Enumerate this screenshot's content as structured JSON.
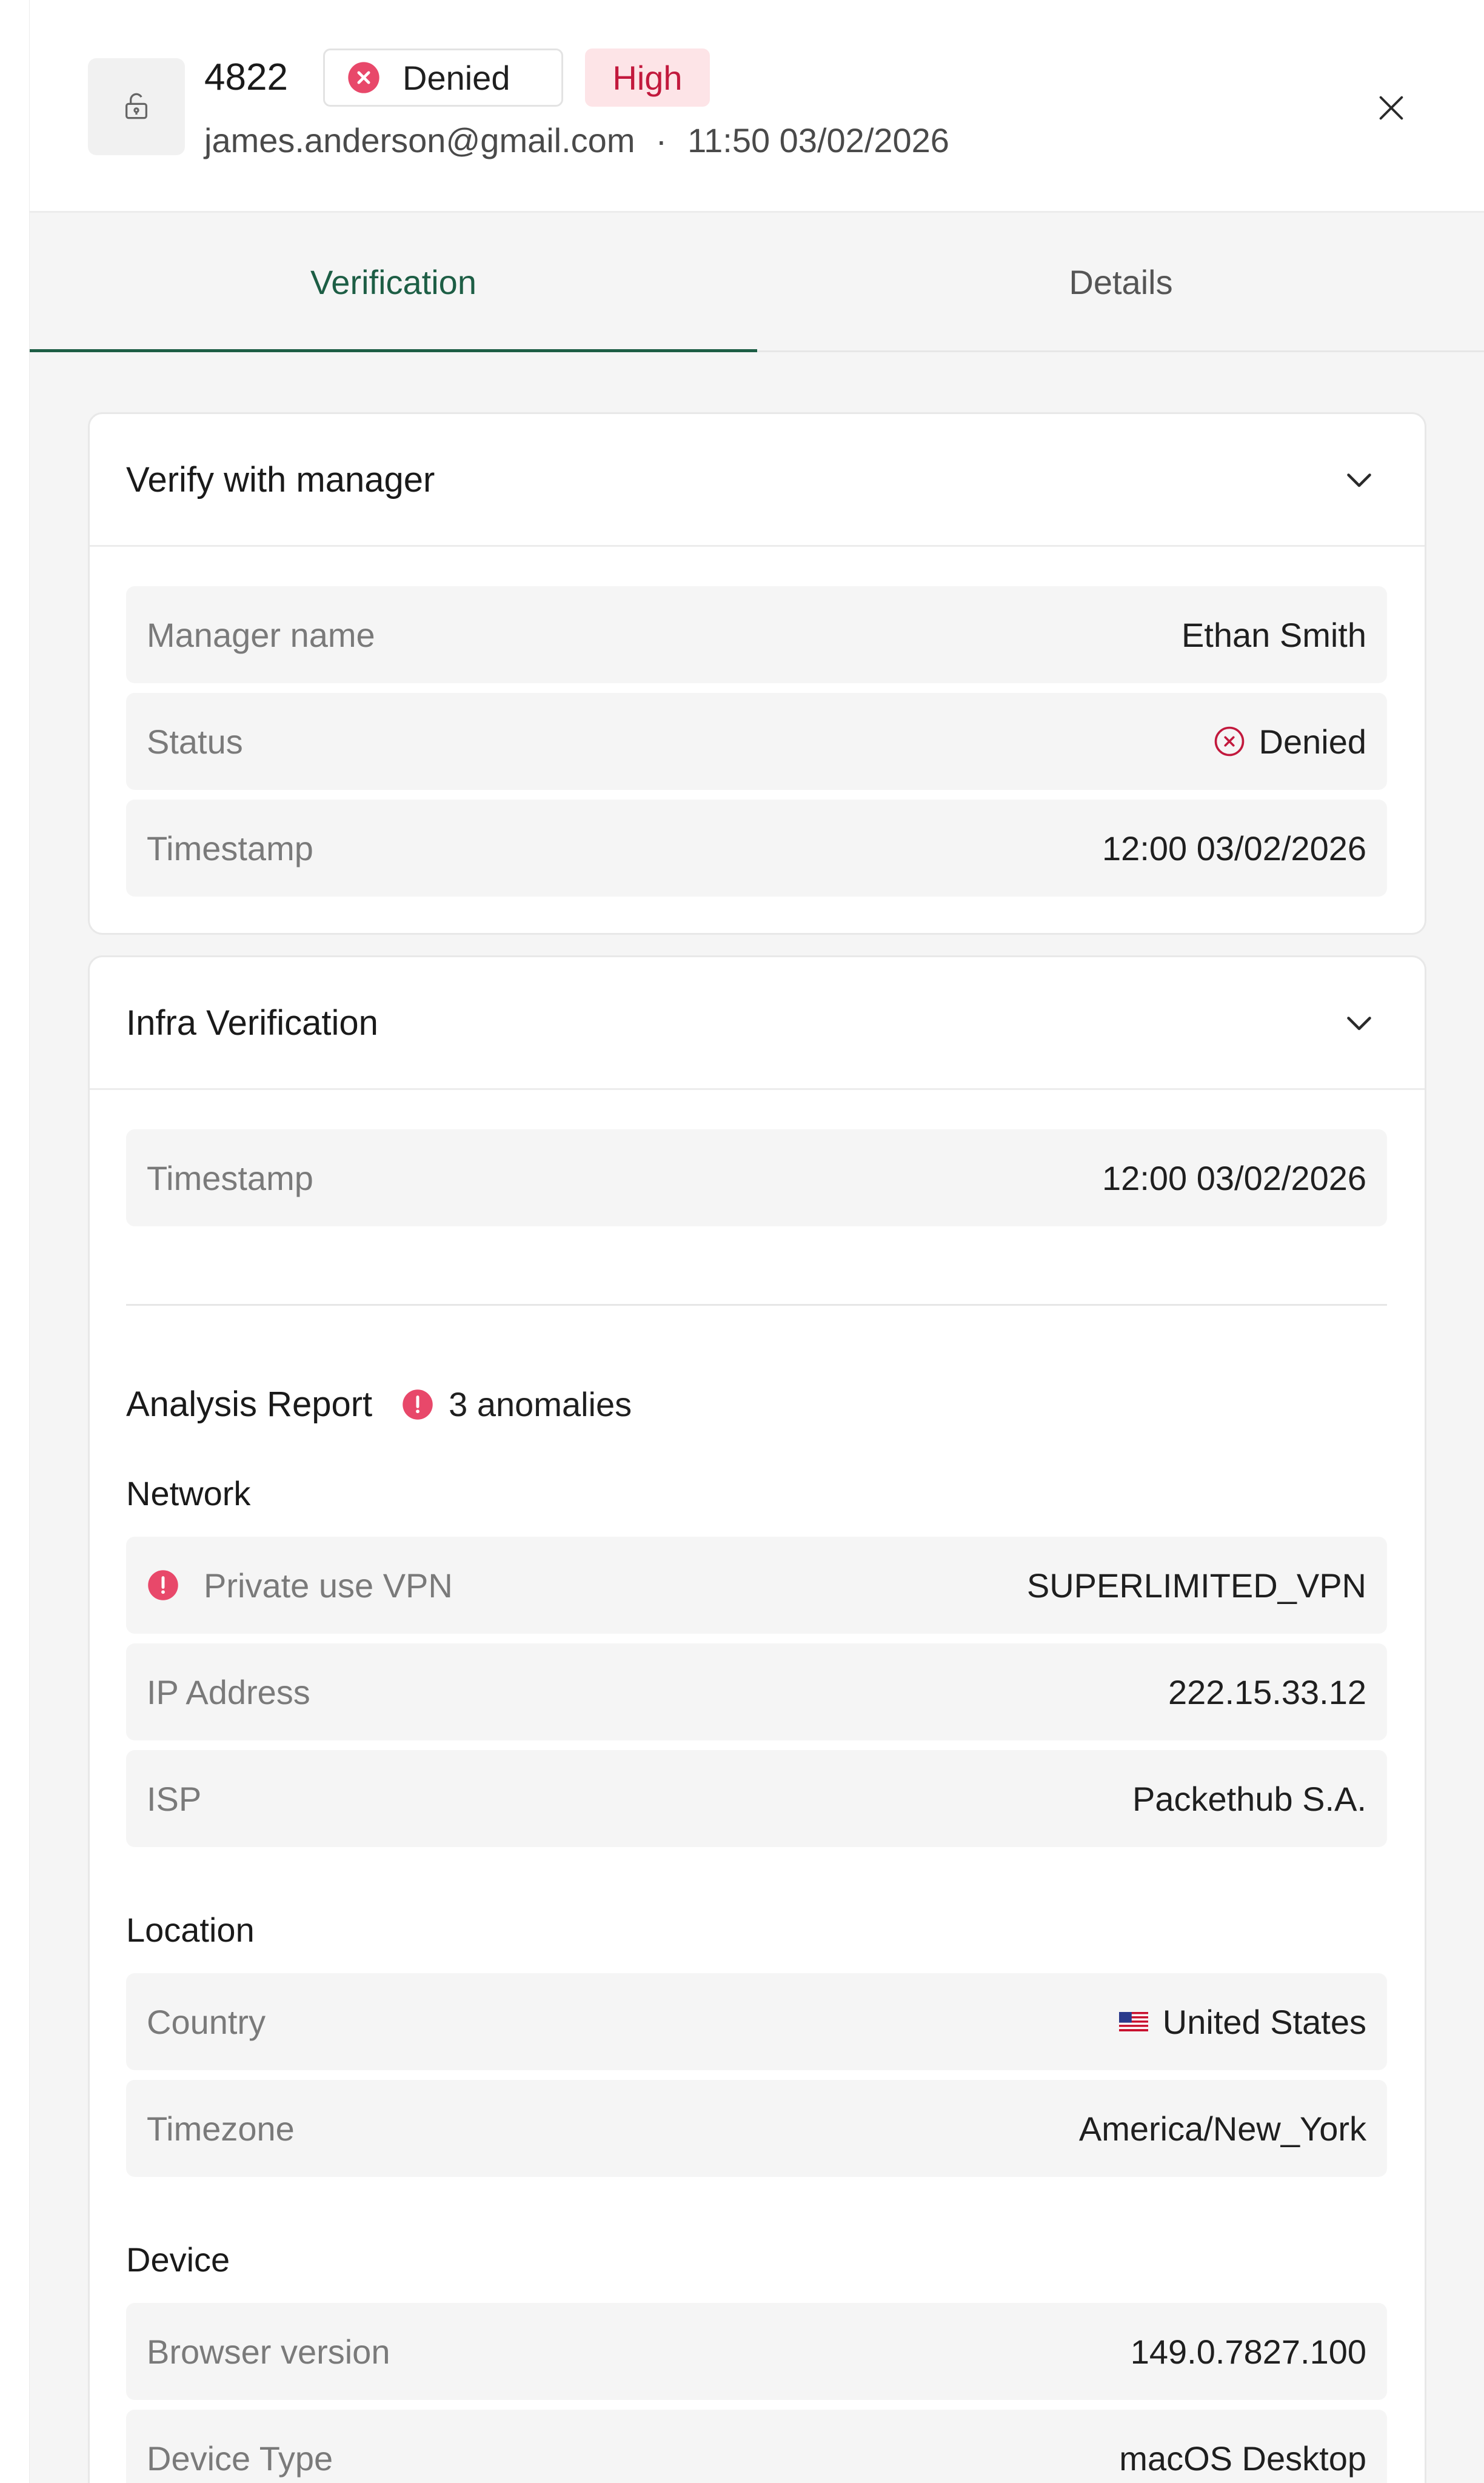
{
  "header": {
    "request_id": "4822",
    "status_label": "Denied",
    "severity_label": "High",
    "email": "james.anderson@gmail.com",
    "separator": "·",
    "time": "11:50 03/02/2026"
  },
  "tabs": [
    {
      "label": "Verification",
      "active": true
    },
    {
      "label": "Details",
      "active": false
    }
  ],
  "manager_card": {
    "title": "Verify with manager",
    "rows": [
      {
        "label": "Manager name",
        "value": "Ethan Smith"
      },
      {
        "label": "Status",
        "value": "Denied"
      },
      {
        "label": "Timestamp",
        "value": "12:00 03/02/2026"
      }
    ]
  },
  "infra_card": {
    "title": "Infra Verification",
    "timestamp_label": "Timestamp",
    "timestamp_value": "12:00 03/02/2026",
    "report_title": "Analysis Report",
    "anomalies_label": "3 anomalies",
    "network": {
      "heading": "Network",
      "rows": [
        {
          "label": "Private use VPN",
          "value": "SUPERLIMITED_VPN",
          "anomaly": true
        },
        {
          "label": "IP Address",
          "value": "222.15.33.12"
        },
        {
          "label": "ISP",
          "value": "Packethub S.A."
        }
      ]
    },
    "location": {
      "heading": "Location",
      "rows": [
        {
          "label": "Country",
          "value": "United States",
          "flag": "us-flag-icon"
        },
        {
          "label": "Timezone",
          "value": "America/New_York"
        }
      ]
    },
    "device": {
      "heading": "Device",
      "rows": [
        {
          "label": "Browser version",
          "value": "149.0.7827.100"
        },
        {
          "label": "Device Type",
          "value": "macOS Desktop"
        }
      ]
    }
  },
  "colors": {
    "accent": "#1d5e45",
    "danger": "#e8486a",
    "severity_bg": "#fde4e7",
    "severity_text": "#c2193d"
  }
}
